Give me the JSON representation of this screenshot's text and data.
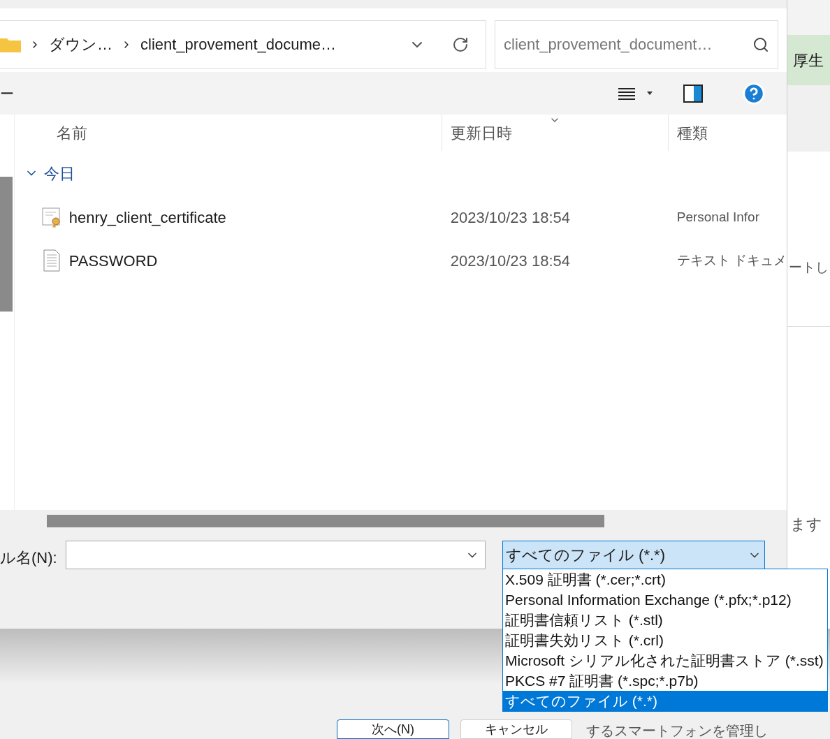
{
  "breadcrumb": {
    "items": [
      "ダウン…",
      "client_provement_docume…"
    ]
  },
  "search": {
    "placeholder": "client_provement_document…"
  },
  "toolbar": {
    "left_label": "ー"
  },
  "columns": [
    "名前",
    "更新日時",
    "種類"
  ],
  "groups": [
    {
      "label": "今日",
      "expanded": true,
      "files": [
        {
          "name": "henry_client_certificate",
          "kind": "certificate",
          "modified": "2023/10/23 18:54",
          "type": "Personal Infor"
        },
        {
          "name": "PASSWORD",
          "kind": "text",
          "modified": "2023/10/23 18:54",
          "type": "テキスト ドキュメ"
        }
      ]
    }
  ],
  "filename": {
    "label": "ル名(N):"
  },
  "filetype": {
    "value": "すべてのファイル (*.*)",
    "expanded": true,
    "options": [
      {
        "label": "X.509 証明書 (*.cer;*.crt)",
        "selected": false
      },
      {
        "label": "Personal Information Exchange (*.pfx;*.p12)",
        "selected": false
      },
      {
        "label": "証明書信頼リスト (*.stl)",
        "selected": false
      },
      {
        "label": "証明書失効リスト (*.crl)",
        "selected": false
      },
      {
        "label": "Microsoft シリアル化された証明書ストア (*.sst)",
        "selected": false
      },
      {
        "label": "PKCS #7 証明書 (*.spc;*.p7b)",
        "selected": false
      },
      {
        "label": "すべてのファイル (*.*)",
        "selected": true
      }
    ]
  },
  "buttons": [
    "次へ(N)",
    "キャンセル"
  ],
  "background": {
    "texts": [
      "厚生",
      "ートし",
      "ます",
      "するスマートフォンを管理し"
    ]
  }
}
